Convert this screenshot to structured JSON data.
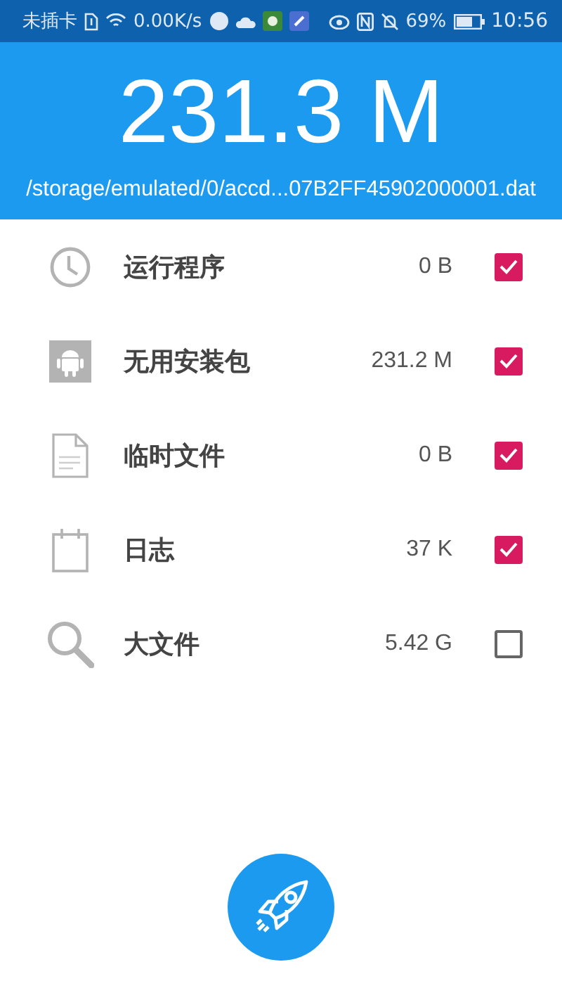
{
  "status_bar": {
    "carrier": "未插卡",
    "speed": "0.00K/s",
    "battery": "69%",
    "time": "10:56"
  },
  "header": {
    "total": "231.3 M",
    "path": "/storage/emulated/0/accd...07B2FF45902000001.dat"
  },
  "items": [
    {
      "kind": "clock",
      "label": "运行程序",
      "size": "0 B",
      "checked": true
    },
    {
      "kind": "android",
      "label": "无用安装包",
      "size": "231.2 M",
      "checked": true
    },
    {
      "kind": "document",
      "label": "临时文件",
      "size": "0 B",
      "checked": true
    },
    {
      "kind": "calendar",
      "label": "日志",
      "size": "37 K",
      "checked": true
    },
    {
      "kind": "search",
      "label": "大文件",
      "size": "5.42 G",
      "checked": false
    }
  ]
}
